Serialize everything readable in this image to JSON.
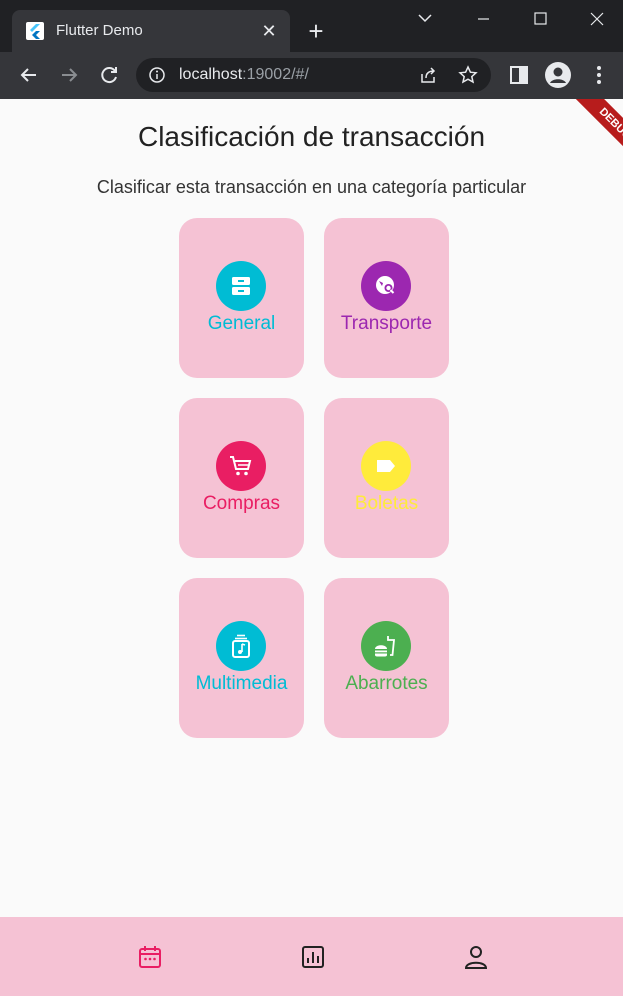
{
  "browser": {
    "tab_title": "Flutter Demo",
    "url_host": "localhost",
    "url_rest": ":19002/#/"
  },
  "page": {
    "title": "Clasificación de transacción",
    "subtitle": "Clasificar esta transacción en una categoría particular",
    "debug_label": "DEBUG"
  },
  "categories": [
    {
      "label": "General",
      "icon": "inbox-icon",
      "color": "#00bcd4"
    },
    {
      "label": "Transporte",
      "icon": "travel-search-icon",
      "color": "#9c27b0"
    },
    {
      "label": "Compras",
      "icon": "shopping-cart-icon",
      "color": "#e91e63"
    },
    {
      "label": "Boletas",
      "icon": "label-tag-icon",
      "color": "#ffeb3b"
    },
    {
      "label": "Multimedia",
      "icon": "media-file-icon",
      "color": "#00bcd4"
    },
    {
      "label": "Abarrotes",
      "icon": "fastfood-icon",
      "color": "#4caf50"
    }
  ],
  "bottom_nav": {
    "active_color": "#e91e63",
    "items": [
      "calendar-icon",
      "stats-icon",
      "profile-icon"
    ]
  }
}
